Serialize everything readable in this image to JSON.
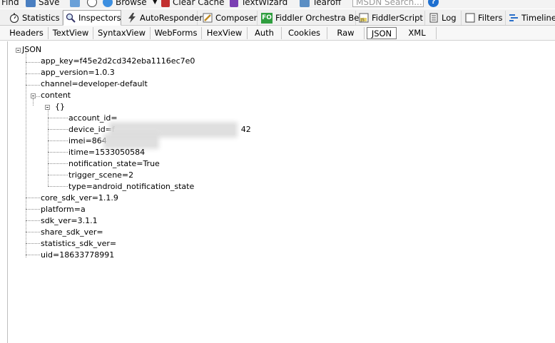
{
  "toolbar": {
    "find": "Find",
    "save": "Save",
    "browse": "Browse",
    "clear_cache": "Clear Cache",
    "textwizard": "TextWizard",
    "tearoff": "Tearoff",
    "msdn_search": "MSDN Search...",
    "help": "?"
  },
  "tabs": [
    {
      "label": "Statistics"
    },
    {
      "label": "Inspectors"
    },
    {
      "label": "AutoResponder"
    },
    {
      "label": "Composer"
    },
    {
      "label": "Fiddler Orchestra Beta",
      "badge": "FO"
    },
    {
      "label": "FiddlerScript",
      "badge": "JS"
    },
    {
      "label": "Log"
    },
    {
      "label": "Filters"
    },
    {
      "label": "Timeline"
    }
  ],
  "active_tab": "Inspectors",
  "subtabs": [
    "Headers",
    "TextView",
    "SyntaxView",
    "WebForms",
    "HexView",
    "Auth",
    "Cookies",
    "Raw",
    "JSON",
    "XML"
  ],
  "active_subtab": "JSON",
  "tree": {
    "root": "JSON",
    "app_key": "app_key=f45e2d2cd342eba1116ec7e0",
    "app_version": "app_version=1.0.3",
    "channel": "channel=developer-default",
    "content": "content",
    "object": "{}",
    "account_id": "account_id=",
    "device_id_prefix": "device_id=f",
    "device_id_suffix": "42",
    "imei_prefix": "imei=864",
    "itime": "itime=1533050584",
    "notification_state": "notification_state=True",
    "trigger_scene": "trigger_scene=2",
    "type": "type=android_notification_state",
    "core_sdk_ver": "core_sdk_ver=1.1.9",
    "platform": "platform=a",
    "sdk_ver": "sdk_ver=3.1.1",
    "share_sdk_ver": "share_sdk_ver=",
    "statistics_sdk_ver": "statistics_sdk_ver=",
    "uid": "uid=18633778991"
  }
}
